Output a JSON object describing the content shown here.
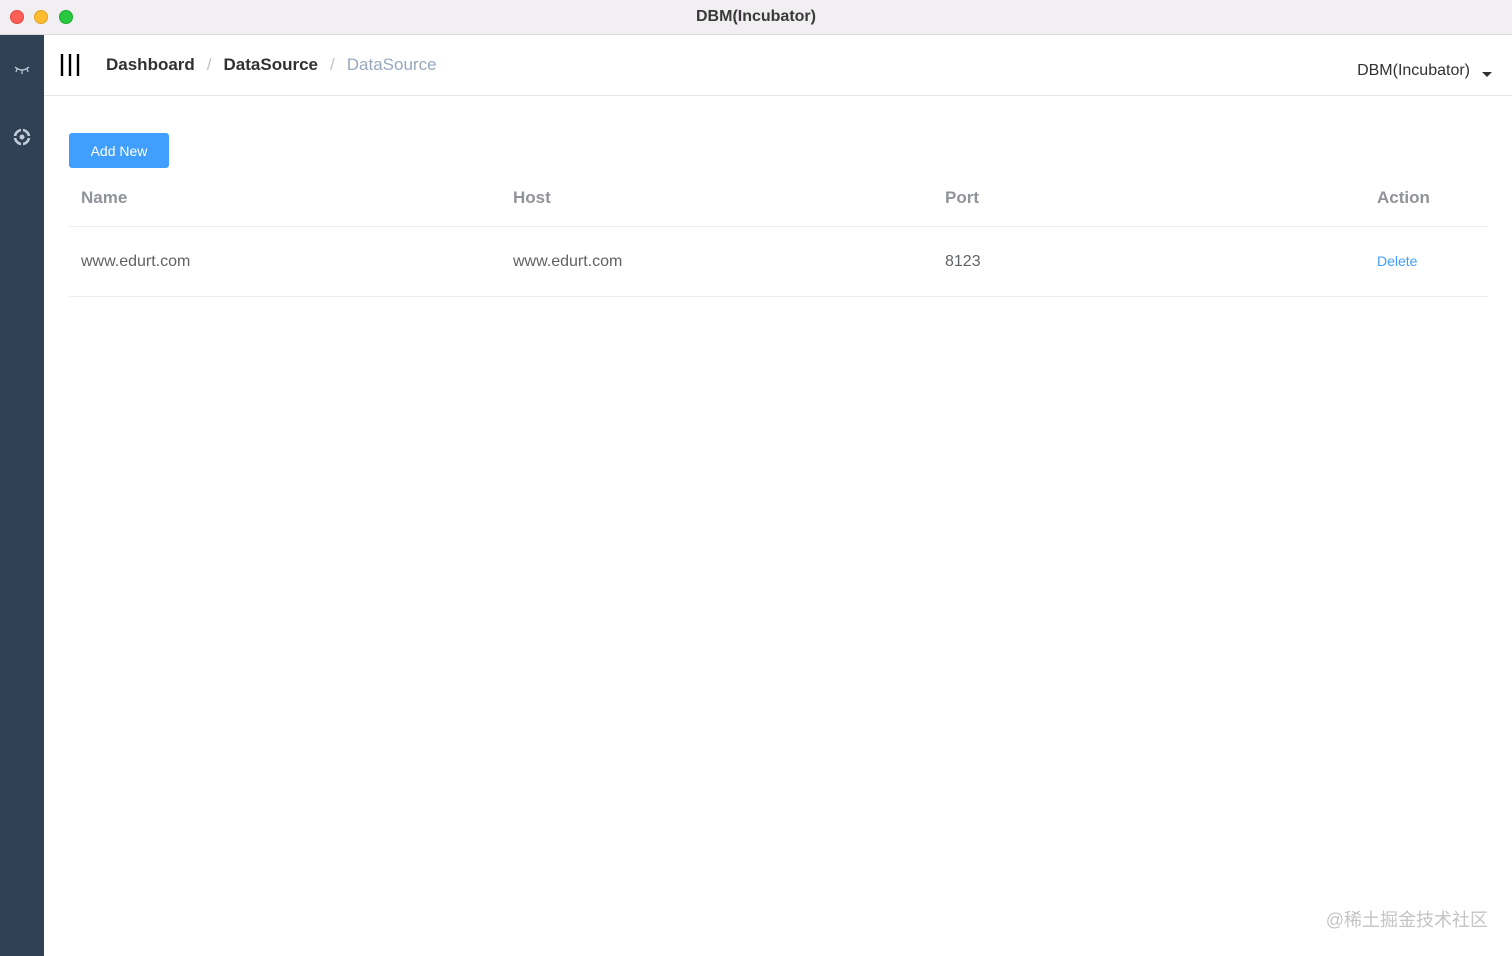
{
  "window": {
    "title": "DBM(Incubator)"
  },
  "sidebar": {
    "icons": [
      "eye-closed-icon",
      "settings-gear-icon"
    ]
  },
  "navbar": {
    "breadcrumb": [
      "Dashboard",
      "DataSource",
      "DataSource"
    ],
    "app_menu_label": "DBM(Incubator)"
  },
  "toolbar": {
    "add_label": "Add New"
  },
  "table": {
    "headers": [
      "Name",
      "Host",
      "Port",
      "Action"
    ],
    "rows": [
      {
        "name": "www.edurt.com",
        "host": "www.edurt.com",
        "port": "8123",
        "action": "Delete"
      }
    ]
  },
  "watermark": "@稀土掘金技术社区",
  "colors": {
    "sidebar": "#304156",
    "primary": "#409eff"
  }
}
